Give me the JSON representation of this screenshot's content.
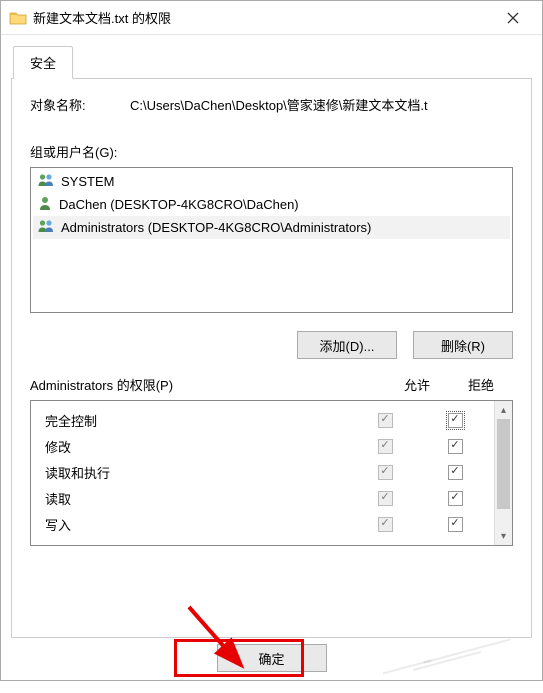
{
  "window": {
    "title": "新建文本文档.txt 的权限",
    "tab_label": "安全"
  },
  "object": {
    "label": "对象名称:",
    "value": "C:\\Users\\DaChen\\Desktop\\管家速修\\新建文本文档.t"
  },
  "groups": {
    "label": "组或用户名(G):",
    "items": [
      {
        "name": "SYSTEM",
        "icon": "group"
      },
      {
        "name": "DaChen (DESKTOP-4KG8CRO\\DaChen)",
        "icon": "user"
      },
      {
        "name": "Administrators (DESKTOP-4KG8CRO\\Administrators)",
        "icon": "group",
        "selected": true
      }
    ],
    "btn_add": "添加(D)...",
    "btn_remove": "删除(R)"
  },
  "permissions": {
    "header_label": "Administrators 的权限(P)",
    "col_allow": "允许",
    "col_deny": "拒绝",
    "rows": [
      {
        "name": "完全控制",
        "allow": "gray-checked",
        "deny": "checked-focus"
      },
      {
        "name": "修改",
        "allow": "gray-checked",
        "deny": "checked"
      },
      {
        "name": "读取和执行",
        "allow": "gray-checked",
        "deny": "checked"
      },
      {
        "name": "读取",
        "allow": "gray-checked",
        "deny": "checked"
      },
      {
        "name": "写入",
        "allow": "gray-checked",
        "deny": "checked"
      }
    ]
  },
  "buttons": {
    "ok": "确定"
  }
}
